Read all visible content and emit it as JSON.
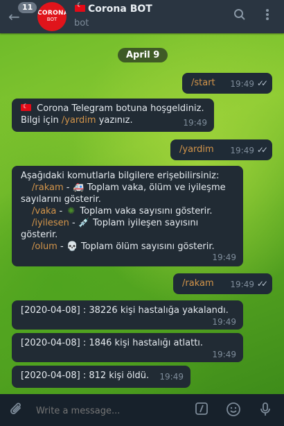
{
  "header": {
    "unread_count": "11",
    "avatar_line1": "CORONA",
    "avatar_line2": "BOT",
    "chat_title": "Corona BOT",
    "chat_subtitle": "bot",
    "back_icon": "arrow-left-icon",
    "search_icon": "search-icon",
    "menu_icon": "more-vertical-icon"
  },
  "chat": {
    "date_label": "April 9",
    "messages": [
      {
        "dir": "out",
        "text": "/start",
        "time": "19:49"
      },
      {
        "dir": "in",
        "line1": " Corona Telegram botuna hoşgeldiniz.",
        "line2_prefix": "Bilgi için ",
        "line2_cmd": "/yardim",
        "line2_suffix": " yazınız.",
        "time": "19:49"
      },
      {
        "dir": "out",
        "text": "/yardim",
        "time": "19:49"
      },
      {
        "dir": "in",
        "intro": "Aşağıdaki komutlarla bilgilere erişebilirsiniz:",
        "items": [
          {
            "cmd": "/rakam",
            "desc": " Toplam vaka, ölüm ve iyileşme",
            "desc2": "sayılarını gösterir."
          },
          {
            "cmd": "/vaka",
            "desc": " Toplam vaka sayısını gösterir."
          },
          {
            "cmd": "/iyilesen",
            "desc": " Toplam iyileşen sayısını",
            "desc2": "gösterir."
          },
          {
            "cmd": "/olum",
            "desc": " Toplam ölüm sayısını gösterir."
          }
        ],
        "time": "19:49"
      },
      {
        "dir": "out",
        "text": "/rakam",
        "time": "19:49"
      },
      {
        "dir": "in",
        "text": "[2020-04-08] : 38226 kişi hastalığa yakalandı.",
        "time": "19:49"
      },
      {
        "dir": "in",
        "text": "[2020-04-08] : 1846 kişi hastalığı atlattı.",
        "time": "19:49"
      },
      {
        "dir": "in",
        "text": "[2020-04-08] : 812 kişi öldü.",
        "time": "19:49"
      }
    ]
  },
  "composer": {
    "placeholder": "Write a message...",
    "attach_icon": "paperclip-icon",
    "command_icon": "slash-command-icon",
    "emoji_icon": "smile-icon",
    "mic_icon": "microphone-icon"
  },
  "colors": {
    "command_text": "#d4954a",
    "bubble_bg": "#212b34",
    "header_bg": "#2a3541"
  }
}
